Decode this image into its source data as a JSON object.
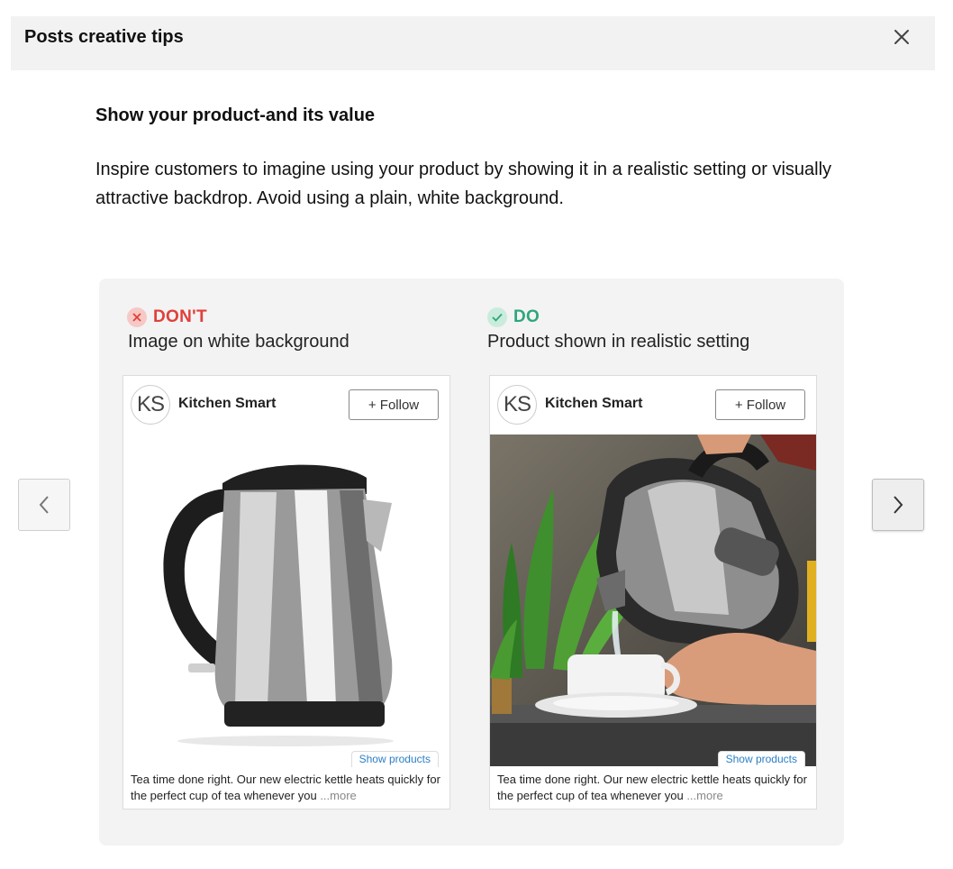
{
  "header": {
    "title": "Posts creative tips",
    "close_icon": "close-icon"
  },
  "tip": {
    "heading": "Show your product-and its value",
    "body": "Inspire customers to imagine using your product by showing it in a realistic setting or visually attractive backdrop. Avoid using a plain, white background."
  },
  "nav": {
    "prev_icon": "chevron-left-icon",
    "next_icon": "chevron-right-icon"
  },
  "colors": {
    "dont": "#e0403a",
    "do": "#2ea67a",
    "link": "#2a7fc6"
  },
  "examples": [
    {
      "verdict": "DON'T",
      "verdict_icon": "x-circle-icon",
      "caption": "Image on white background",
      "post": {
        "avatar_initials": "KS",
        "brand": "Kitchen Smart",
        "follow_label": "+ Follow",
        "show_products_label": "Show products",
        "text": "Tea time done right. Our new electric kettle heats quickly for the perfect cup of tea whenever you ",
        "more_label": "...more",
        "image": "kettle-on-white-background"
      }
    },
    {
      "verdict": "DO",
      "verdict_icon": "check-circle-icon",
      "caption": "Product shown in realistic setting",
      "post": {
        "avatar_initials": "KS",
        "brand": "Kitchen Smart",
        "follow_label": "+ Follow",
        "show_products_label": "Show products",
        "text": "Tea time done right. Our new electric kettle heats quickly for the perfect cup of tea whenever you ",
        "more_label": "...more",
        "image": "kettle-pouring-into-cup"
      }
    }
  ]
}
